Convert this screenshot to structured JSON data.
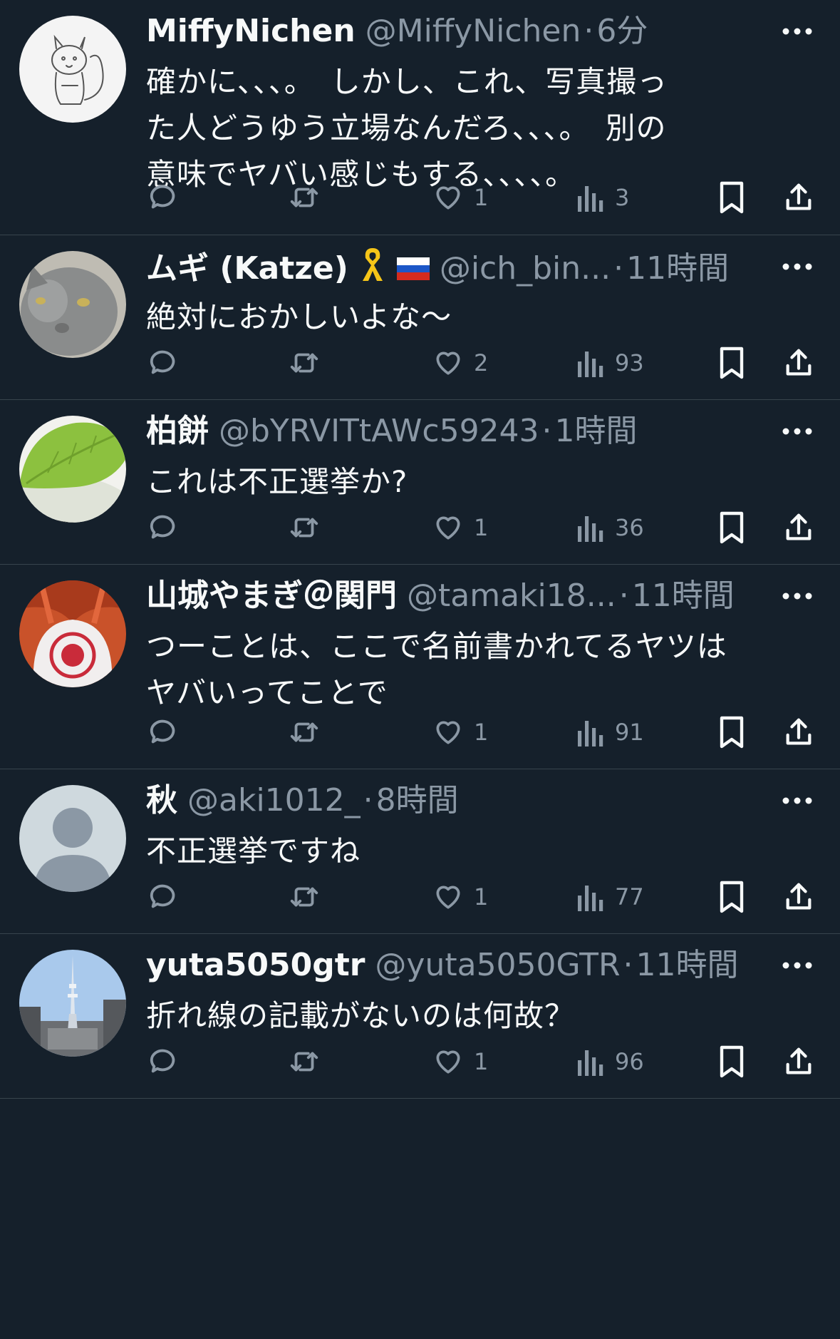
{
  "tweets": [
    {
      "display_name": "MiffyNichen",
      "handle": "@MiffyNichen",
      "time": "6分",
      "text": "確かに、、、。　しかし、これ、写真撮っ\nた人どうゆう立場なんだろ、、、。　別の\n意味でヤバい感じもする、、、、。",
      "likes": "1",
      "views": "3",
      "avatar": "squirrel-drawing"
    },
    {
      "display_name": "ムギ (Katze)",
      "handle": "@ich_bin...",
      "time": "11時間",
      "text": "絶対におかしいよな〜",
      "likes": "2",
      "views": "93",
      "avatar": "gray-cat-photo",
      "badges": [
        "yellow-ribbon-emoji",
        "russian-flag-emoji"
      ]
    },
    {
      "display_name": "柏餅",
      "handle": "@bYRVITtAWc59243",
      "time": "1時間",
      "text": "これは不正選挙か?",
      "likes": "1",
      "views": "36",
      "avatar": "kashiwa-mochi"
    },
    {
      "display_name": "山城やまぎ＠関門",
      "handle": "@tamaki18...",
      "time": "11時間",
      "text": "つーことは、ここで名前書かれてるヤツは\nヤバいってことで",
      "likes": "1",
      "views": "91",
      "avatar": "shirt-photo"
    },
    {
      "display_name": "秋",
      "handle": "@aki1012_",
      "time": "8時間",
      "text": "不正選挙ですね",
      "likes": "1",
      "views": "77",
      "avatar": "default-avatar"
    },
    {
      "display_name": "yuta5050gtr",
      "handle": "@yuta5050GTR",
      "time": "11時間",
      "text": "折れ線の記載がないのは何故？",
      "likes": "1",
      "views": "96",
      "avatar": "tower-photo"
    }
  ],
  "colors": {
    "background": "#15202b",
    "divider": "#38444d",
    "text_primary": "#f7f9f9",
    "text_secondary": "#8b98a5"
  }
}
